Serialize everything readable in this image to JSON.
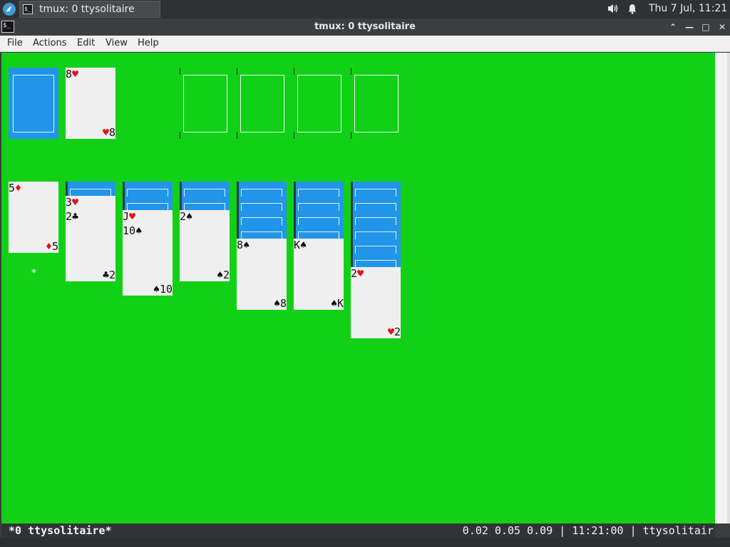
{
  "panel": {
    "task_title": "tmux: 0 ttysolitaire",
    "task_icon_text": "$_",
    "clock": "Thu  7 Jul, 11:21",
    "volume_icon": "speaker-icon",
    "bell_icon": "bell-icon"
  },
  "window": {
    "title": "tmux: 0 ttysolitaire",
    "icon_text": "$_",
    "btn_up": "⌃",
    "btn_min": "—",
    "btn_max": "□",
    "btn_close": "✕"
  },
  "menu": {
    "file": "File",
    "actions": "Actions",
    "edit": "Edit",
    "view": "View",
    "help": "Help"
  },
  "game": {
    "waste": {
      "rank_tl": "8",
      "suit": "♥",
      "rank_br": "8"
    },
    "cursor": "*",
    "tableau": [
      {
        "top": {
          "rank": "5",
          "suit": "♦",
          "color": "red"
        }
      },
      {
        "under": {
          "rank": "3",
          "suit": "♥"
        },
        "top": {
          "rank": "2",
          "suit": "♣",
          "color": "black"
        }
      },
      {
        "under": {
          "rank": "J",
          "suit": "♥"
        },
        "top": {
          "rank": "10",
          "suit": "♠",
          "color": "black"
        }
      },
      {
        "top": {
          "rank": "2",
          "suit": "♠",
          "color": "black"
        }
      },
      {
        "top": {
          "rank": "8",
          "suit": "♠",
          "color": "black"
        }
      },
      {
        "top": {
          "rank": "K",
          "suit": "♠",
          "color": "black"
        }
      },
      {
        "top": {
          "rank": "2",
          "suit": "♥",
          "color": "red"
        }
      }
    ]
  },
  "statusbar": {
    "left": "*0 ttysolitaire*",
    "right": "0.02 0.05 0.09 | 11:21:00 | ttysolitair"
  },
  "colors": {
    "felt": "#11d117",
    "card_back": "#2196e8",
    "card_face": "#efefef",
    "red_suit": "#e5101b"
  }
}
